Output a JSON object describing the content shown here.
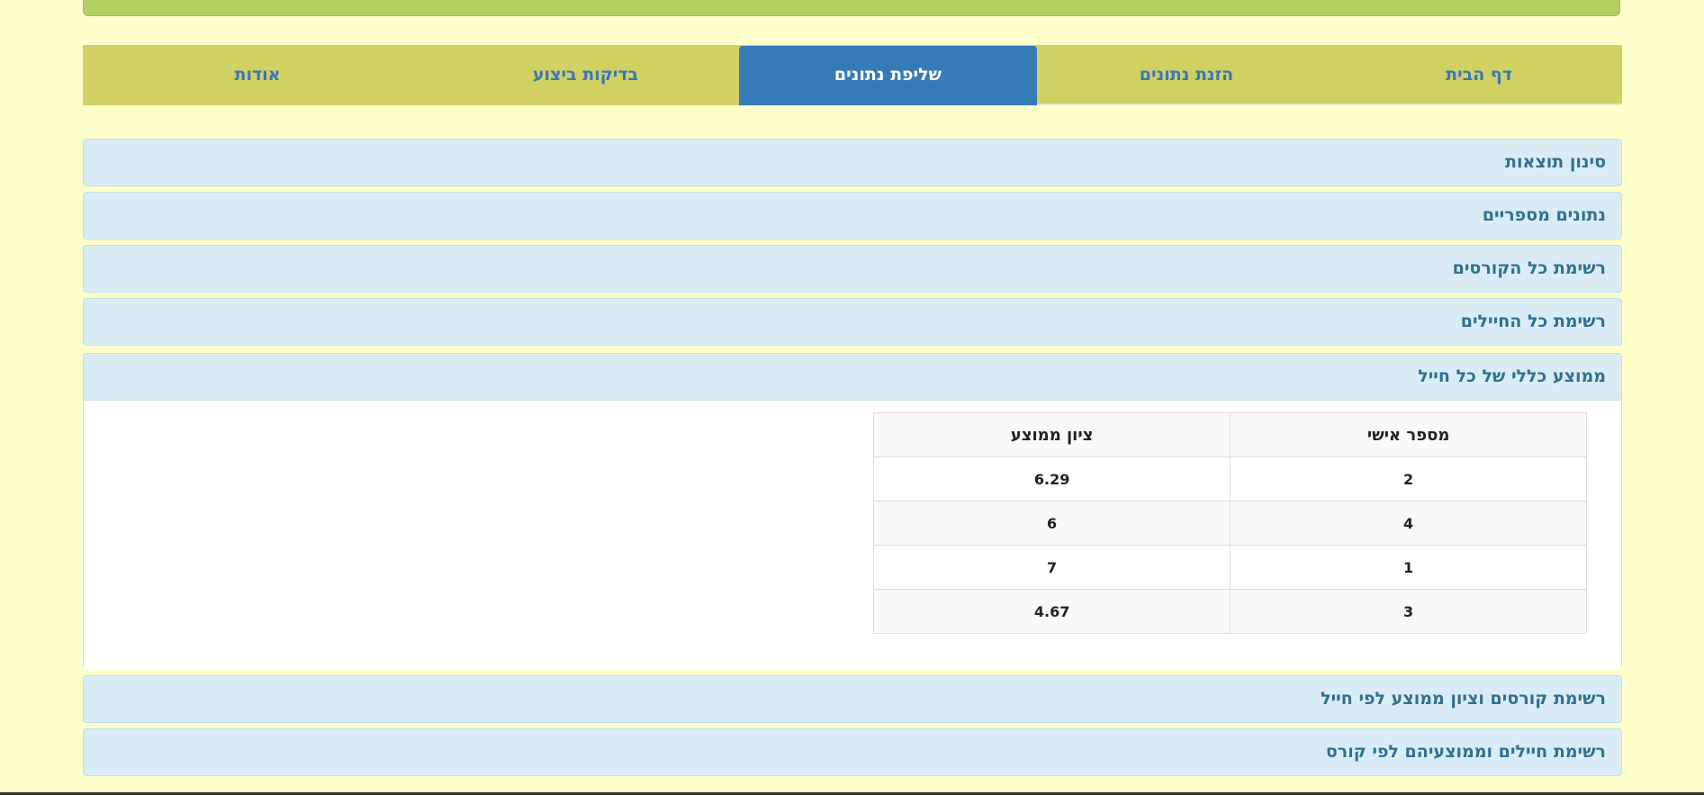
{
  "nav": {
    "tabs": [
      {
        "label": "דף הבית"
      },
      {
        "label": "הזנת נתונים"
      },
      {
        "label": "שליפת נתונים"
      },
      {
        "label": "בדיקות ביצוע"
      },
      {
        "label": "אודות"
      }
    ],
    "active_tab": "שליפת נתונים"
  },
  "panels": [
    {
      "title": "סינון תוצאות"
    },
    {
      "title": "נתונים מספריים"
    },
    {
      "title": "רשימת כל הקורסים"
    },
    {
      "title": "רשימת כל החיילים"
    },
    {
      "title": "ממוצע כללי של כל חייל"
    },
    {
      "title": "רשימת קורסים וציון ממוצע לפי חייל"
    },
    {
      "title": "רשימת חיילים וממוצעיהם לפי קורס"
    }
  ],
  "average_table": {
    "headers": [
      "מספר אישי",
      "ציון ממוצע"
    ],
    "rows": [
      [
        "2",
        "6.29"
      ],
      [
        "4",
        "6"
      ],
      [
        "1",
        "7"
      ],
      [
        "3",
        "4.67"
      ]
    ]
  },
  "colors": {
    "background": "#ffffcc",
    "tab_bar": "#d1d063",
    "tab_active": "#357bb8",
    "tab_text": "#3a77b7",
    "panel_bg": "#d9ecf5",
    "panel_text": "#31708f",
    "top_bar": "#b6cf64"
  }
}
